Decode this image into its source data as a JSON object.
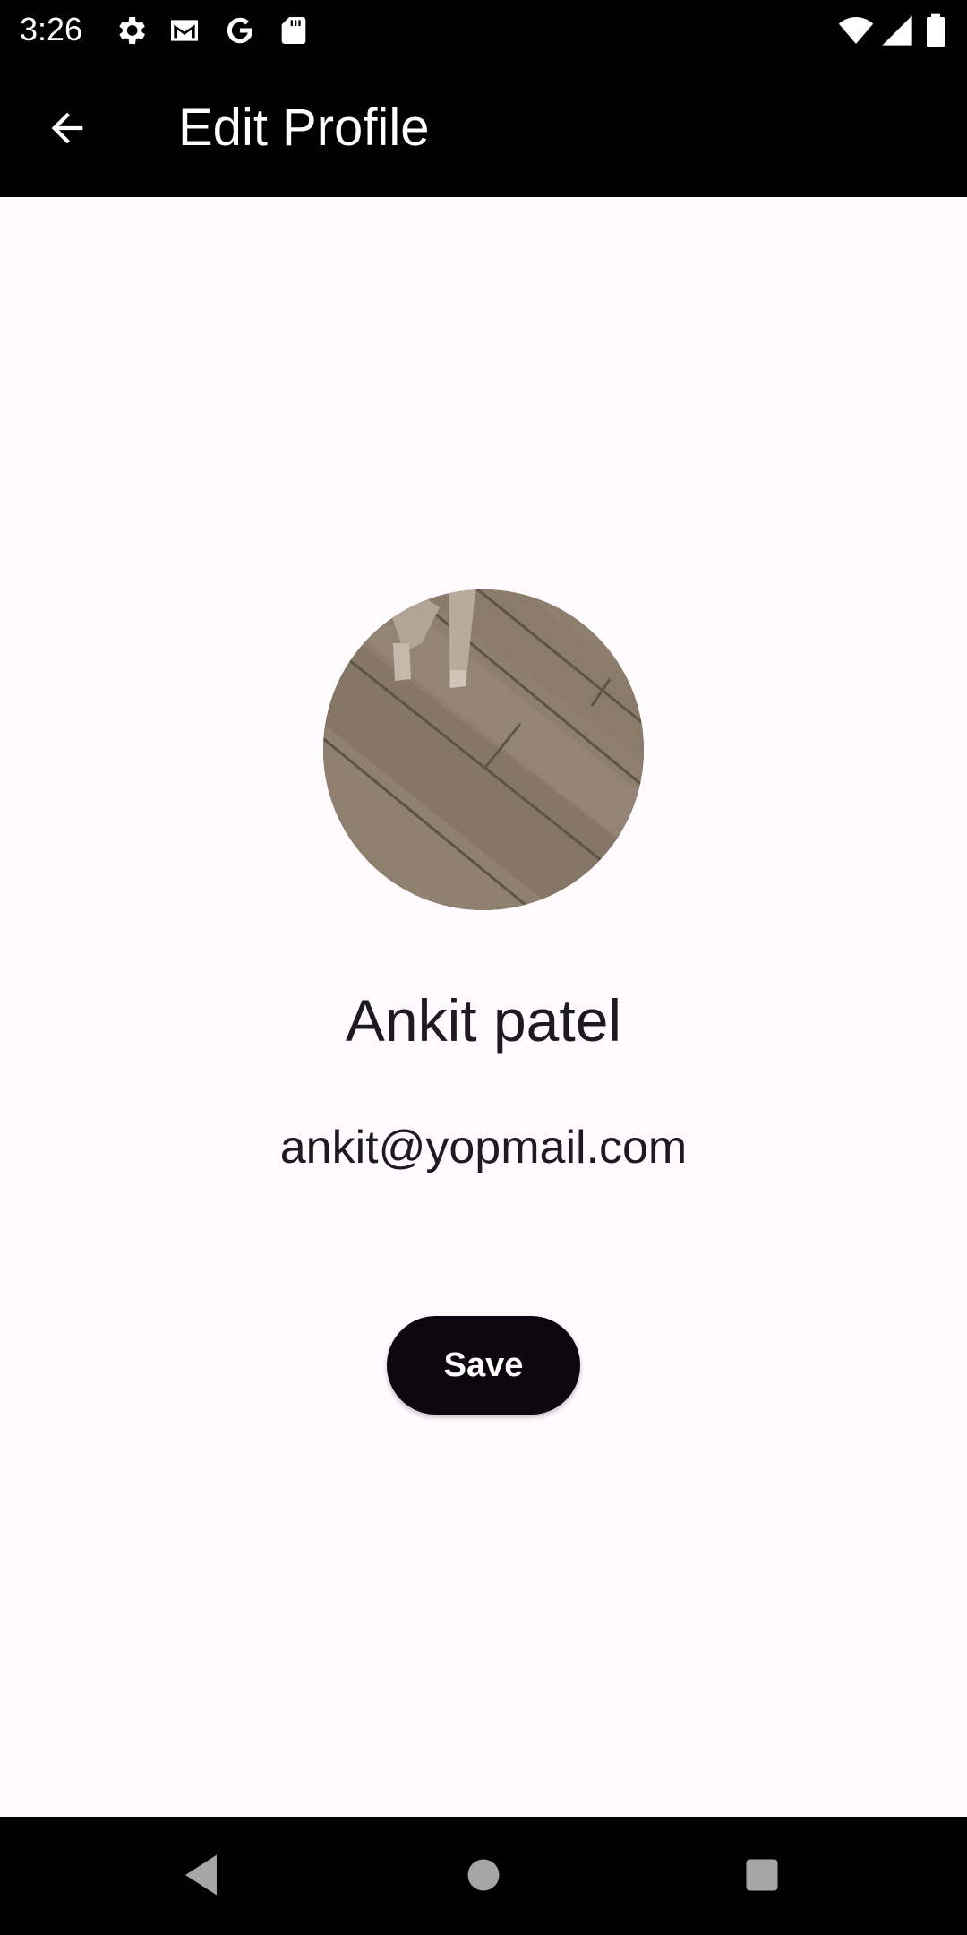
{
  "status_bar": {
    "time": "3:26",
    "left_icons": [
      "settings-icon",
      "gmail-icon",
      "google-icon",
      "sd-card-icon"
    ],
    "right_icons": [
      "wifi-icon",
      "cell-signal-icon",
      "battery-icon"
    ]
  },
  "app_bar": {
    "back_icon": "arrow-back-icon",
    "title": "Edit Profile"
  },
  "profile": {
    "avatar": "profile-photo",
    "name": "Ankit patel",
    "email": "ankit@yopmail.com"
  },
  "actions": {
    "save_label": "Save"
  },
  "nav_bar": {
    "buttons": [
      "back-triangle-icon",
      "home-circle-icon",
      "recents-square-icon"
    ]
  },
  "colors": {
    "bars": "#000000",
    "background": "#fffbfe",
    "text": "#1c1b1f",
    "button": "#0b0610",
    "button_text": "#ffffff"
  }
}
